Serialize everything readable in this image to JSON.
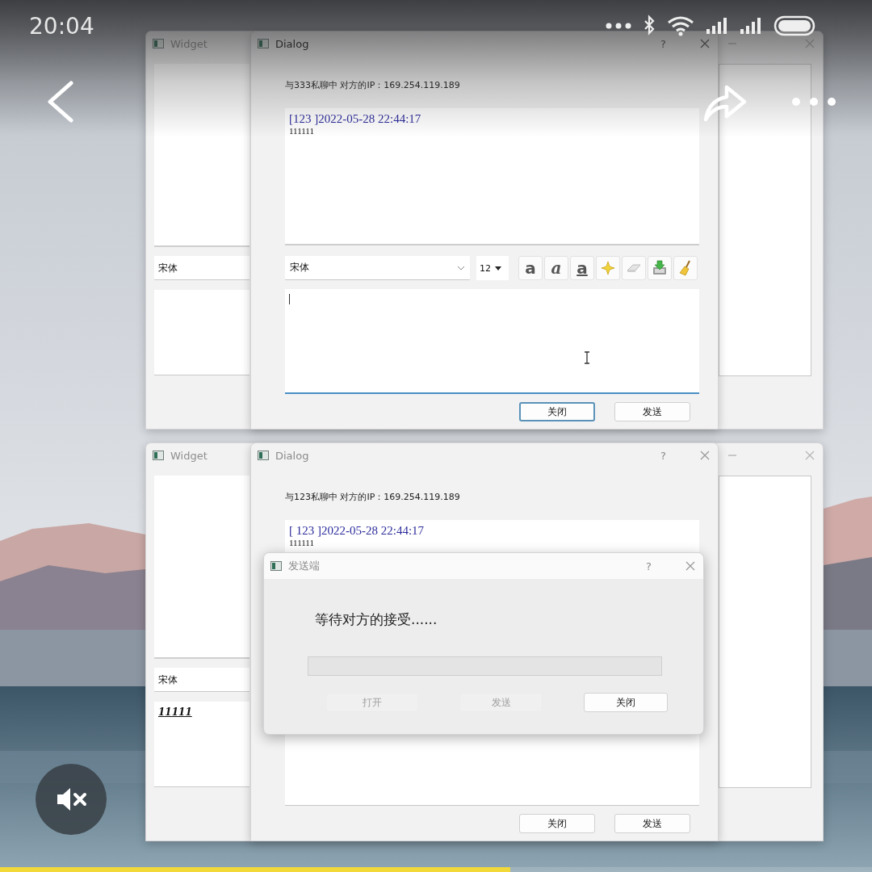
{
  "status_bar": {
    "time": "20:04"
  },
  "player": {
    "muted": true,
    "progress": {
      "level": 0.585
    }
  },
  "scenes": [
    {
      "widget": {
        "title": "Widget",
        "font_combo": "宋体"
      },
      "dialog": {
        "title": "Dialog",
        "help": "?",
        "active": true,
        "header": "与333私聊中 对方的IP：169.254.119.189",
        "messages": [
          {
            "meta": "[123 ]2022-05-28 22:44:17",
            "body": "111111"
          }
        ],
        "toolbar": {
          "font": "宋体",
          "size": "12",
          "tools": [
            {
              "kind": "bold",
              "glyph": "a"
            },
            {
              "kind": "italic",
              "glyph": "a"
            },
            {
              "kind": "underline",
              "glyph": "a"
            },
            {
              "kind": "color"
            },
            {
              "kind": "eraser"
            },
            {
              "kind": "save"
            },
            {
              "kind": "clear"
            }
          ]
        },
        "input_focused": true,
        "mouse_pointer": true,
        "buttons": [
          {
            "label": "关闭",
            "focused": true
          },
          {
            "label": "发送",
            "focused": false
          }
        ]
      }
    },
    {
      "widget": {
        "title": "Widget",
        "font_combo": "宋体",
        "input_value": "11111"
      },
      "dialog": {
        "title": "Dialog",
        "help": "?",
        "active": false,
        "header": "与123私聊中 对方的IP：169.254.119.189",
        "messages": [
          {
            "meta": "[ 123 ]2022-05-28 22:44:17",
            "body": "111111"
          }
        ],
        "input_focused": false,
        "mouse_pointer": false,
        "buttons": [
          {
            "label": "关闭",
            "focused": false
          },
          {
            "label": "发送",
            "focused": false
          }
        ]
      },
      "send_dialog": {
        "title": "发送端",
        "help": "?",
        "status": "等待对方的接受......",
        "progress": {
          "level": 0
        },
        "buttons": [
          {
            "label": "打开",
            "disabled": true
          },
          {
            "label": "发送",
            "disabled": true
          },
          {
            "label": "关闭",
            "disabled": false
          }
        ]
      }
    }
  ]
}
